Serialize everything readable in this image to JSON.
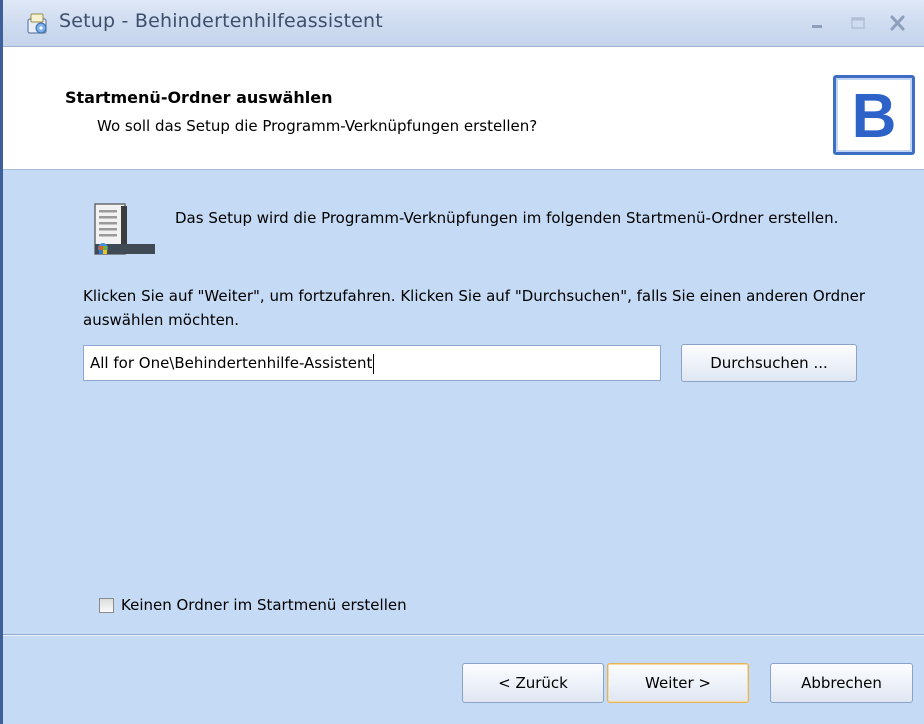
{
  "window": {
    "title": "Setup - Behindertenhilfeassistent",
    "title_icon": "setup-icon",
    "controls": [
      "minimize",
      "maximize",
      "close"
    ]
  },
  "header": {
    "title": "Startmenü-Ordner auswählen",
    "subtitle": "Wo soll das Setup die Programm-Verknüpfungen erstellen?",
    "logo_letter": "B"
  },
  "content": {
    "info_text": "Das Setup wird die Programm-Verknüpfungen im folgenden Startmenü-Ordner erstellen.",
    "instruction_text": "Klicken Sie auf \"Weiter\", um fortzufahren. Klicken Sie auf \"Durchsuchen\", falls Sie einen anderen Ordner auswählen möchten.",
    "folder_path": "All for One\\Behindertenhilfe-Assistent",
    "browse_label": "Durchsuchen ...",
    "no_folder_label": "Keinen Ordner im Startmenü erstellen",
    "no_folder_checked": false
  },
  "buttons": {
    "back": "< Zurück",
    "next": "Weiter >",
    "cancel": "Abbrechen"
  },
  "colors": {
    "body_bg": "#c5daf5",
    "logo_blue": "#2d63c8",
    "default_button_border": "#e6b35b"
  }
}
